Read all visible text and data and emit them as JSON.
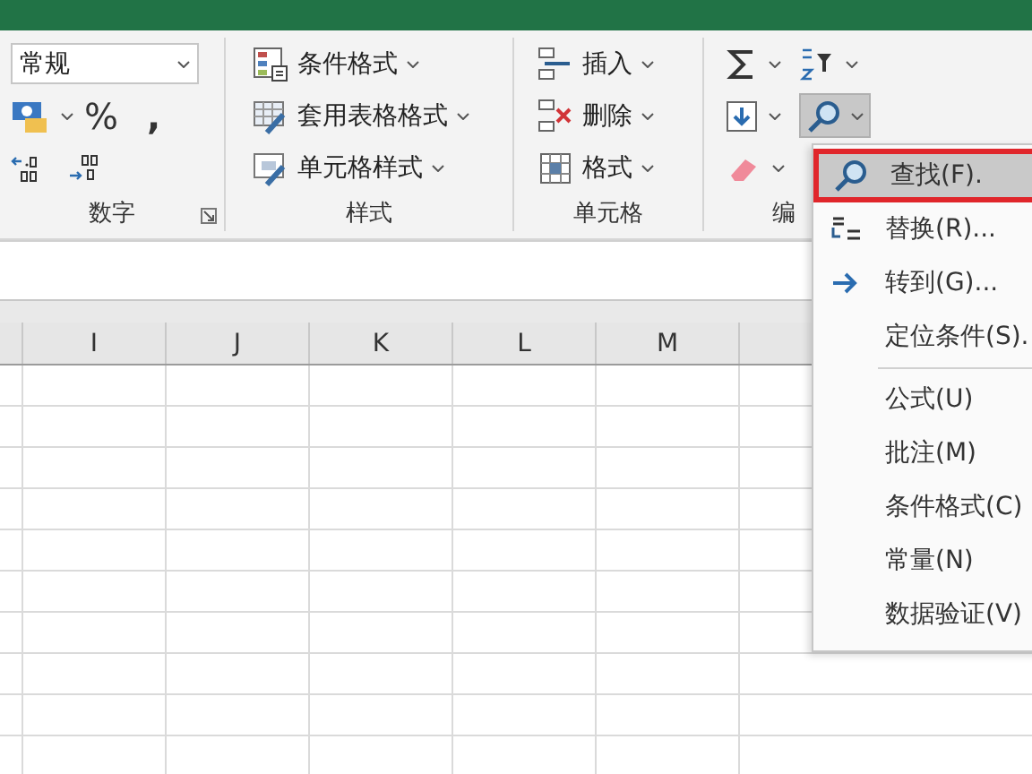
{
  "number_group": {
    "label": "数字",
    "format_value": "常规",
    "percent": "%",
    "comma": ","
  },
  "styles_group": {
    "label": "样式",
    "items": [
      "条件格式",
      "套用表格格式",
      "单元格样式"
    ]
  },
  "cells_group": {
    "label": "单元格",
    "items": [
      "插入",
      "删除",
      "格式"
    ]
  },
  "editing_group": {
    "label": "编",
    "find_pressed": true
  },
  "columns": [
    "I",
    "J",
    "K",
    "L",
    "M"
  ],
  "menu": {
    "sections": [
      [
        {
          "label": "查找(F).",
          "selected": true
        },
        {
          "label": "替换(R)...",
          "selected": false
        },
        {
          "label": "转到(G)...",
          "selected": false
        },
        {
          "label": "定位条件(S).",
          "selected": false
        }
      ],
      [
        {
          "label": "公式(U)",
          "selected": false
        },
        {
          "label": "批注(M)",
          "selected": false
        },
        {
          "label": "条件格式(C)",
          "selected": false
        },
        {
          "label": "常量(N)",
          "selected": false
        },
        {
          "label": "数据验证(V)",
          "selected": false
        }
      ]
    ]
  }
}
